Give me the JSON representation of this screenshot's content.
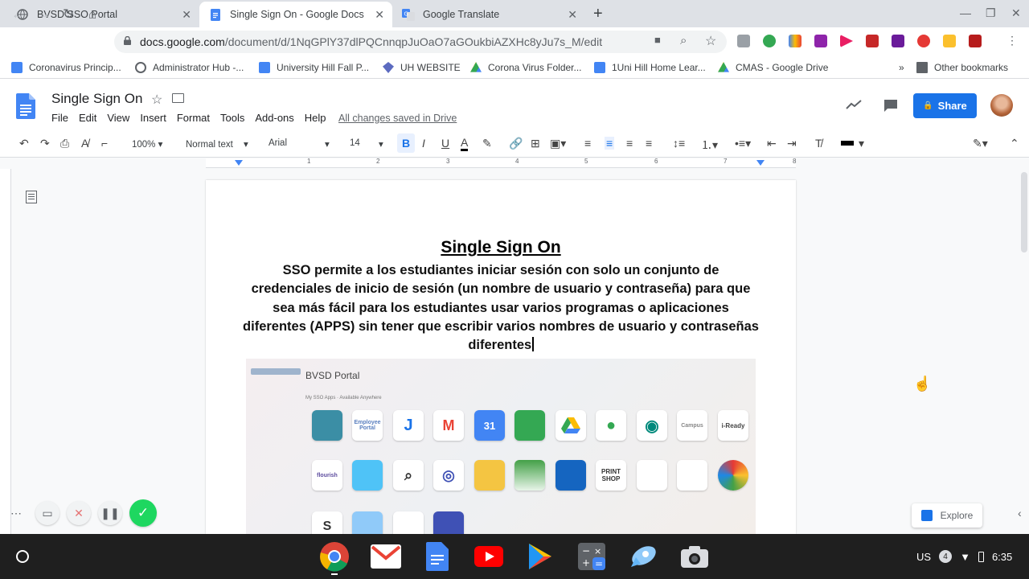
{
  "tabs": [
    {
      "title": "BVSD SSO Portal",
      "active": false
    },
    {
      "title": "Single Sign On - Google Docs",
      "active": true
    },
    {
      "title": "Google Translate",
      "active": false
    }
  ],
  "address": {
    "domain": "docs.google.com",
    "path": "/document/d/1NqGPlY37dlPQCnnqpJuOaO7aGOukbiAZXHc8yJu7s_M/edit"
  },
  "bookmarks": [
    "Coronavirus Princip...",
    "Administrator Hub -...",
    "University Hill Fall P...",
    "UH WEBSITE",
    "Corona Virus Folder...",
    "1Uni Hill Home Lear...",
    "CMAS - Google Drive"
  ],
  "other_bookmarks": "Other bookmarks",
  "doc": {
    "title": "Single Sign On",
    "menus": [
      "File",
      "Edit",
      "View",
      "Insert",
      "Format",
      "Tools",
      "Add-ons",
      "Help"
    ],
    "saved_status": "All changes saved in Drive",
    "share_label": "Share",
    "heading": "Single Sign On",
    "body": "SSO permite a los estudiantes iniciar sesión con solo un conjunto de credenciales de inicio de sesión (un nombre de usuario y contraseña) para que sea más fácil para los estudiantes usar varios programas o aplicaciones diferentes (APPS) sin tener que escribir varios nombres de usuario y contraseñas diferentes"
  },
  "format_bar": {
    "zoom": "100%",
    "style": "Normal text",
    "font": "Arial",
    "size": "14"
  },
  "ruler_ticks": [
    "1",
    "2",
    "3",
    "4",
    "5",
    "6",
    "7",
    "8"
  ],
  "portal": {
    "title": "BVSD Portal",
    "subtitle": "My SSO Apps · Available Anywhere",
    "apps_row1": [
      "",
      "Employee Portal",
      "",
      "",
      "31",
      "",
      "",
      "",
      "",
      "Campus",
      "i-Ready"
    ],
    "apps_row2": [
      "flourish",
      "",
      "",
      "",
      "",
      "",
      "",
      "PRINT SHOP",
      "",
      "",
      ""
    ],
    "apps_row3": [
      "S",
      "",
      "",
      ""
    ]
  },
  "explore_label": "Explore",
  "system_tray": {
    "locale": "US",
    "notifications": "4",
    "time": "6:35"
  },
  "colors": {
    "accent": "#1a73e8",
    "shelf": "#1f1f1f",
    "record_green": "#1ed760"
  }
}
